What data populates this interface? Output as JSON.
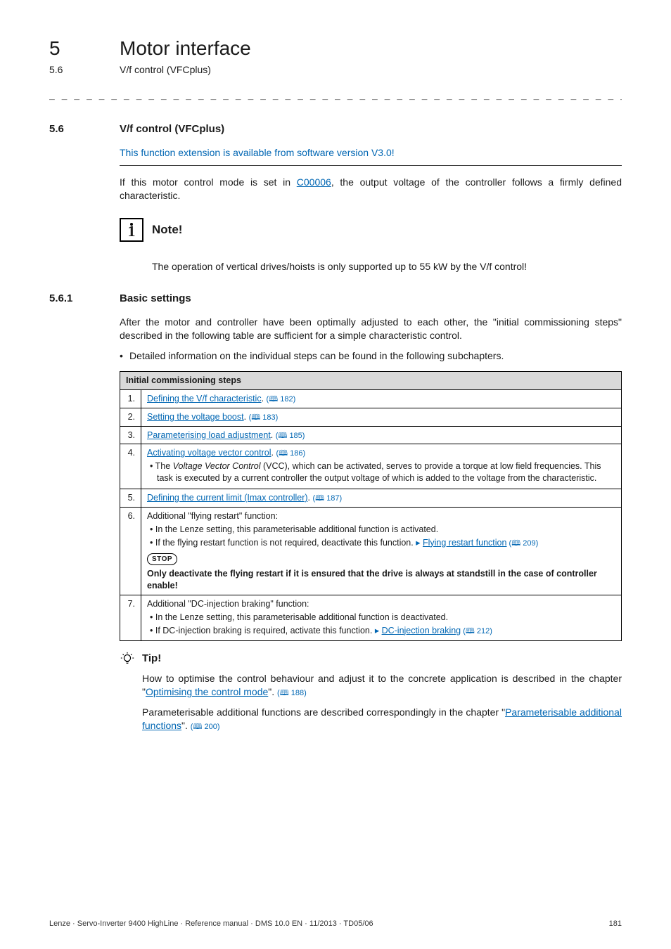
{
  "header": {
    "chapter_num": "5",
    "chapter_title": "Motor interface",
    "sub_num": "5.6",
    "sub_title": "V/f control (VFCplus)"
  },
  "dashes": "_ _ _ _ _ _ _ _ _ _ _ _ _ _ _ _ _ _ _ _ _ _ _ _ _ _ _ _ _ _ _ _ _ _ _ _ _ _ _ _ _ _ _ _ _ _ _ _ _ _ _ _ _ _ _ _ _ _ _ _ _ _ _ _",
  "section56": {
    "num": "5.6",
    "title": "V/f control (VFCplus)",
    "extension_note": "This function extension is available from software version V3.0!",
    "para_pre": "If this motor control mode is set in ",
    "para_link": "C00006",
    "para_post": ", the output voltage of the controller follows a firmly defined characteristic.",
    "note_label": "Note!",
    "note_text": "The operation of vertical drives/hoists is only supported up to 55 kW by the V/f control!"
  },
  "section561": {
    "num": "5.6.1",
    "title": "Basic settings",
    "intro": "After the motor and controller have been optimally adjusted to each other, the \"initial commissioning steps\" described in the following table are sufficient for a simple characteristic control.",
    "bullet": "Detailed information on the individual steps can be found in the following subchapters.",
    "table_header": "Initial commissioning steps",
    "rows": {
      "r1": {
        "n": "1.",
        "link": "Defining the V/f characteristic",
        "sep": ". ",
        "pg": "(🕮 182)"
      },
      "r2": {
        "n": "2.",
        "link": "Setting the voltage boost",
        "sep": ". ",
        "pg": "(🕮 183)"
      },
      "r3": {
        "n": "3.",
        "link": "Parameterising load adjustment",
        "sep": ". ",
        "pg": "(🕮 185)"
      },
      "r4": {
        "n": "4.",
        "link": "Activating voltage vector control",
        "sep": ". ",
        "pg": "(🕮 186)",
        "b1_pre": "The ",
        "b1_ital": "Voltage Vector Control",
        "b1_post": " (VCC), which can be activated, serves to provide a torque at low field frequencies. This task is executed by a current controller the output voltage of which is added to the voltage from the characteristic."
      },
      "r5": {
        "n": "5.",
        "link": "Defining the current limit (Imax controller)",
        "sep": ". ",
        "pg": "(🕮 187)"
      },
      "r6": {
        "n": "6.",
        "t1": "Additional \"flying restart\" function:",
        "b1": "In the Lenze setting, this parameterisable additional function is activated.",
        "b2_pre": "If the flying restart function is not required, deactivate this function. ",
        "b2_arrow": "▸",
        "b2_link": "Flying restart function",
        "b2_pg": " (🕮 209)",
        "stop": "STOP",
        "warn": "Only deactivate the flying restart if it is ensured that the drive is always at standstill in the case of controller enable!"
      },
      "r7": {
        "n": "7.",
        "t1": "Additional \"DC-injection braking\" function:",
        "b1": "In the Lenze setting, this parameterisable additional function is deactivated.",
        "b2_pre": "If DC-injection braking is required, activate this function. ",
        "b2_arrow": "▸",
        "b2_link": "DC-injection braking",
        "b2_pg": " (🕮 212)"
      }
    },
    "tip_label": "Tip!",
    "tip1_pre": "How to optimise the control behaviour and adjust it to the concrete application is described in the chapter \"",
    "tip1_link": "Optimising the control mode",
    "tip1_post": "\". ",
    "tip1_pg": "(🕮 188)",
    "tip2_pre": "Parameterisable additional functions are described correspondingly in the chapter \"",
    "tip2_link": "Parameterisable additional functions",
    "tip2_post": "\". ",
    "tip2_pg": "(🕮 200)"
  },
  "footer": {
    "left": "Lenze · Servo-Inverter 9400 HighLine · Reference manual · DMS 10.0 EN · 11/2013 · TD05/06",
    "right": "181"
  }
}
